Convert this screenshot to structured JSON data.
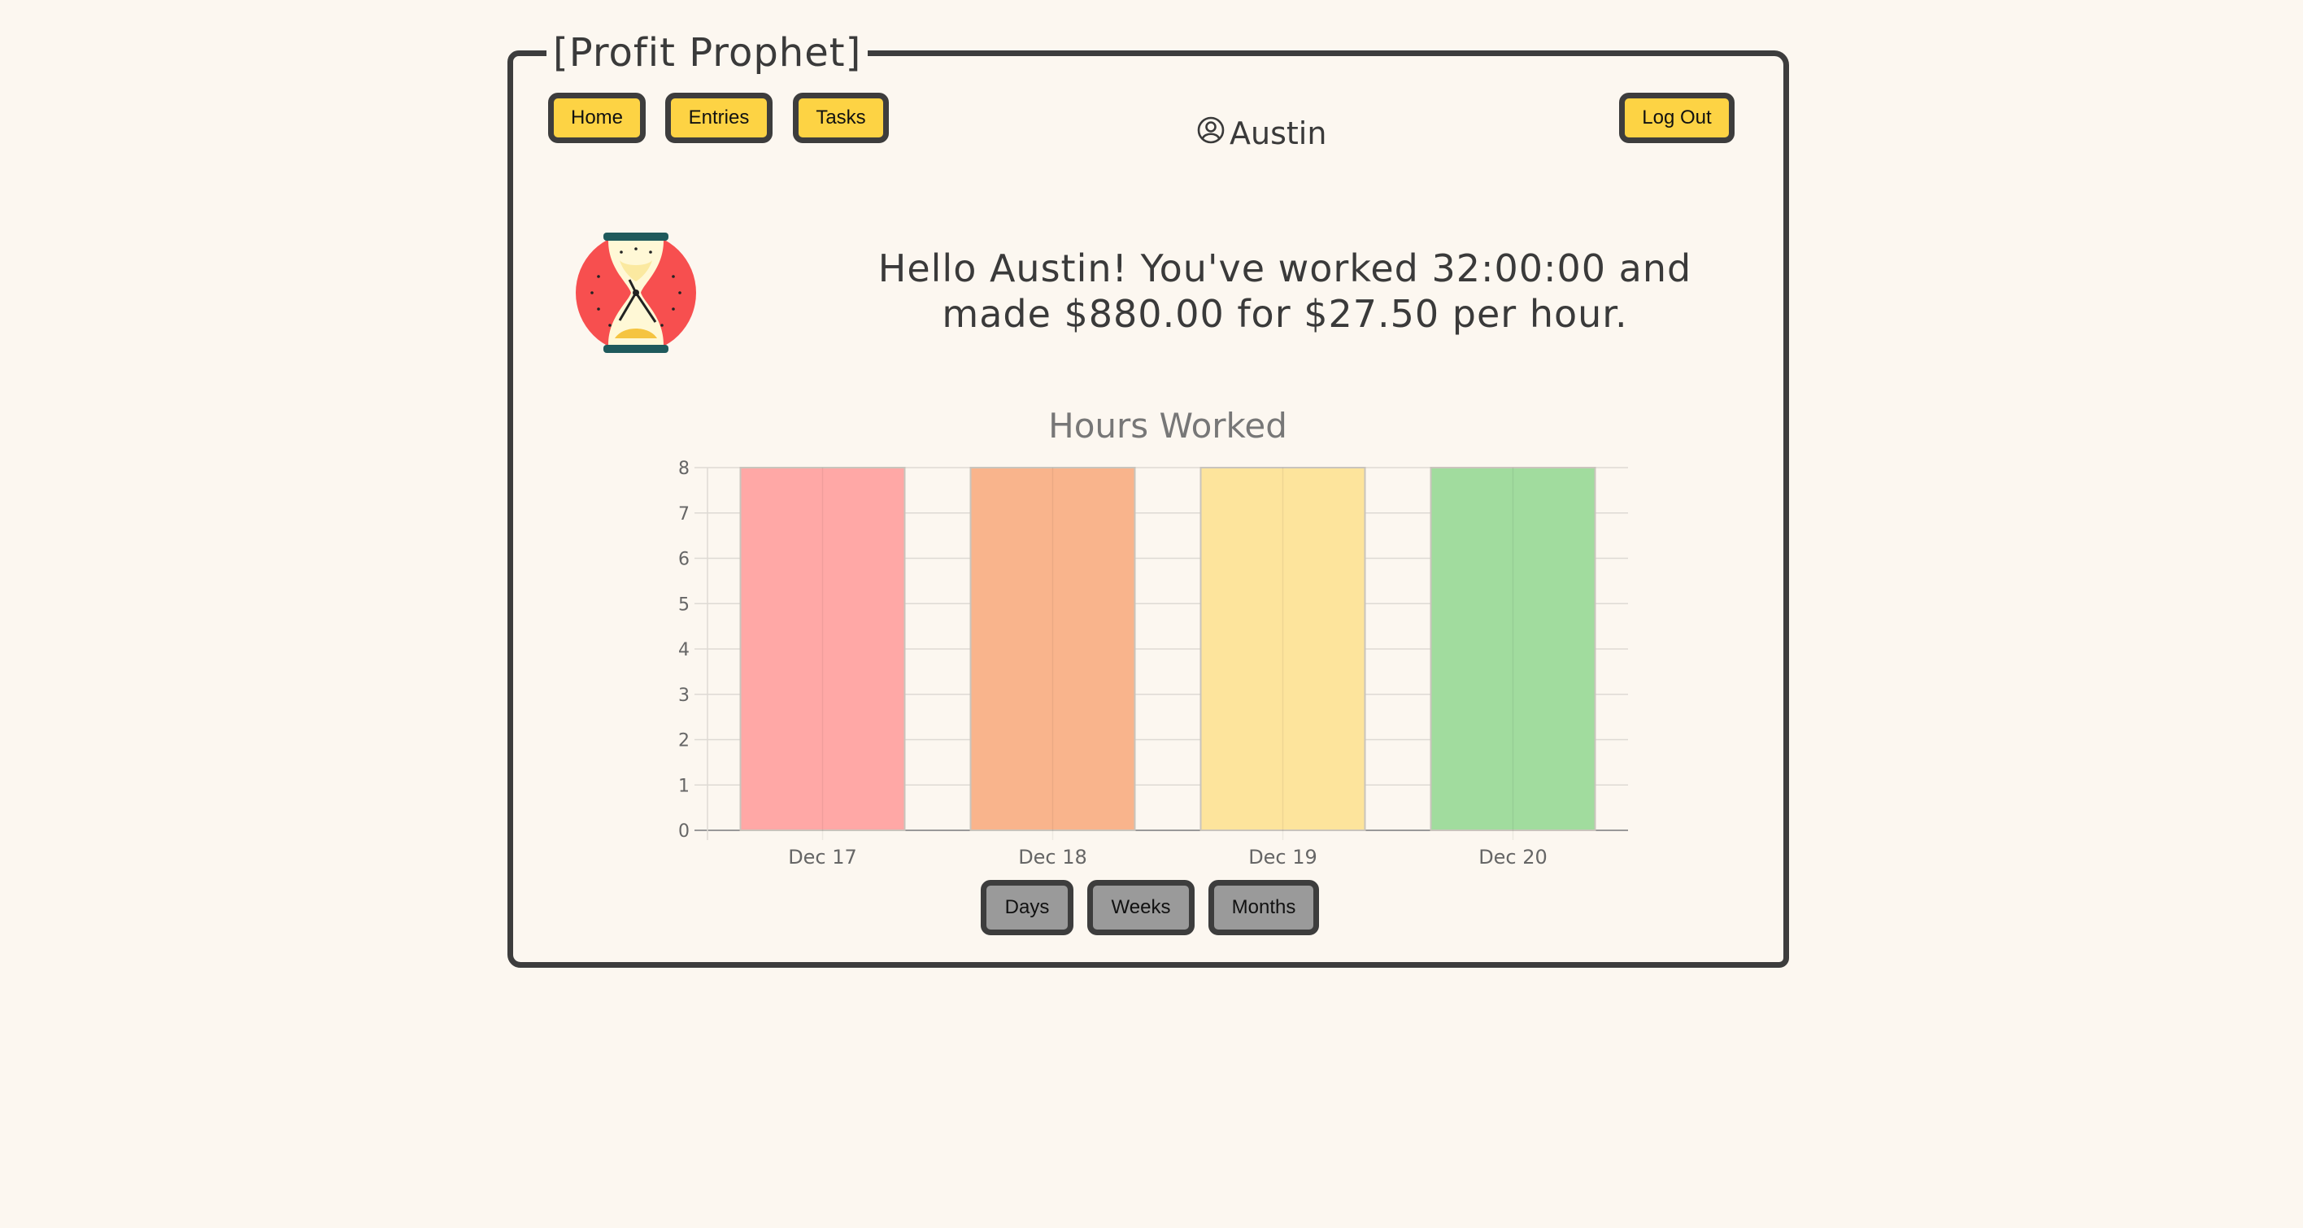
{
  "app": {
    "title": "[Profit Prophet]"
  },
  "nav": {
    "home": "Home",
    "entries": "Entries",
    "tasks": "Tasks",
    "logout": "Log Out"
  },
  "user": {
    "name": "Austin"
  },
  "greeting": {
    "line1": "Hello Austin! You've worked 32:00:00 and",
    "line2": "made $880.00 for $27.50 per hour."
  },
  "range_buttons": {
    "days": "Days",
    "weeks": "Weeks",
    "months": "Months"
  },
  "chart_data": {
    "type": "bar",
    "title": "Hours Worked",
    "categories": [
      "Dec 17",
      "Dec 18",
      "Dec 19",
      "Dec 20"
    ],
    "values": [
      8,
      8,
      8,
      8
    ],
    "colors": [
      "#ffa8a6",
      "#f9b48c",
      "#fde49c",
      "#a1dc9e"
    ],
    "ylim": [
      0,
      8
    ],
    "yticks": [
      "0",
      "1",
      "2",
      "3",
      "4",
      "5",
      "6",
      "7",
      "8"
    ],
    "grid": true
  }
}
